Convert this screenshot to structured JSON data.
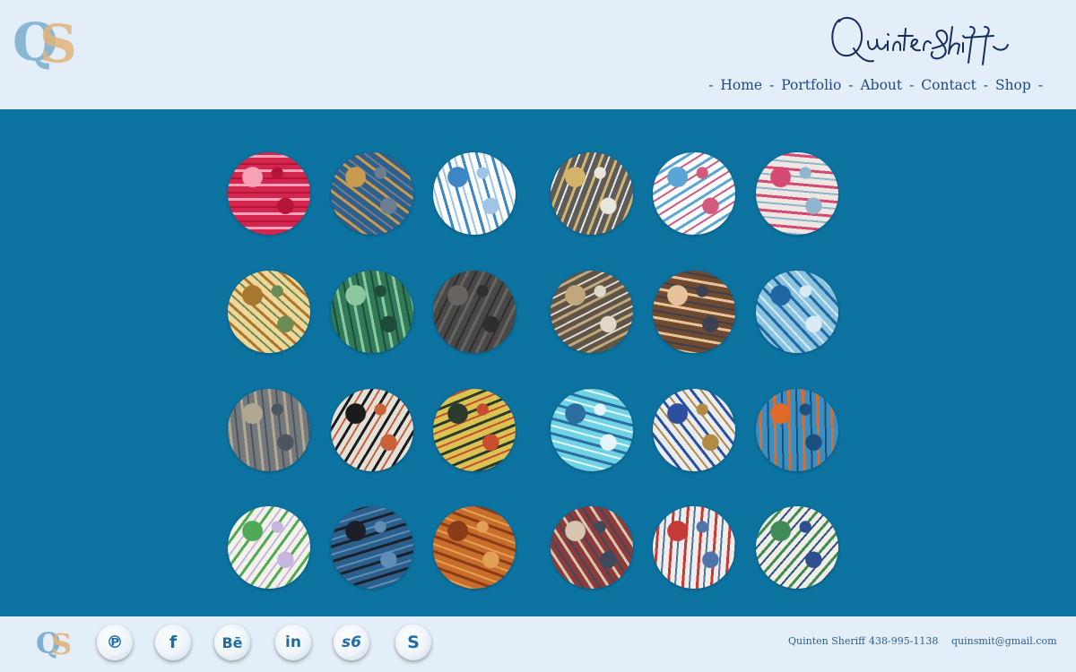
{
  "header": {
    "logo_letters": [
      "Q",
      "S"
    ],
    "signature_text": "QuintenSheriff",
    "nav": {
      "home": "Home",
      "portfolio": "Portfolio",
      "about": "About",
      "contact": "Contact",
      "shop": "Shop",
      "separator": "-"
    }
  },
  "gallery": {
    "thumbnails": [
      {
        "name": "artwork-red-bubbles",
        "colors": [
          "#d2264e",
          "#f7a1b6",
          "#b51437"
        ]
      },
      {
        "name": "artwork-blue-gold-texture",
        "colors": [
          "#2f5f8b",
          "#c99a4f",
          "#6d7e93"
        ]
      },
      {
        "name": "artwork-blue-scribble",
        "colors": [
          "#ffffff",
          "#3d86c6",
          "#9fc4e6"
        ]
      },
      {
        "name": "artwork-collage-gold-black",
        "colors": [
          "#5b5b5b",
          "#d4b36a",
          "#e9e6de"
        ]
      },
      {
        "name": "artwork-blue-drips",
        "colors": [
          "#ffffff",
          "#5aa5d6",
          "#d25b7d"
        ]
      },
      {
        "name": "artwork-pink-rose-portrait",
        "colors": [
          "#efe7e2",
          "#d44a74",
          "#8fb5cf"
        ]
      },
      {
        "name": "artwork-bamboo-gold",
        "colors": [
          "#efd79a",
          "#a7772d",
          "#6c8a53"
        ]
      },
      {
        "name": "artwork-green-stripes",
        "colors": [
          "#2f7a57",
          "#8cc7a0",
          "#1e4b3a"
        ]
      },
      {
        "name": "artwork-dark-grain",
        "colors": [
          "#4a4846",
          "#686462",
          "#302e2d"
        ]
      },
      {
        "name": "artwork-collage-boxes",
        "colors": [
          "#5e5548",
          "#c2a77d",
          "#e0d8c8"
        ]
      },
      {
        "name": "artwork-butterflies-collage",
        "colors": [
          "#6f4a2e",
          "#e6c39a",
          "#3d3f52"
        ]
      },
      {
        "name": "artwork-blue-drip-lines",
        "colors": [
          "#89c3df",
          "#1f67a2",
          "#dceaf3"
        ]
      },
      {
        "name": "artwork-grey-feather",
        "colors": [
          "#75797c",
          "#b0a890",
          "#4b5660"
        ]
      },
      {
        "name": "artwork-birds-branches",
        "colors": [
          "#e3e0da",
          "#1b1b1b",
          "#c8623a"
        ]
      },
      {
        "name": "artwork-yellow-silhouettes",
        "colors": [
          "#d9c453",
          "#2c3a2c",
          "#c84c2e"
        ]
      },
      {
        "name": "artwork-turquoise-circles",
        "colors": [
          "#6fd3e6",
          "#2b6e9f",
          "#e6f6f8"
        ]
      },
      {
        "name": "artwork-blue-white-script",
        "colors": [
          "#e9edf2",
          "#2c4f9f",
          "#b38a43"
        ]
      },
      {
        "name": "artwork-blue-orange-band",
        "colors": [
          "#3a8fc0",
          "#e06a2a",
          "#1b4f80"
        ]
      },
      {
        "name": "artwork-green-line-figure",
        "colors": [
          "#f4f3ea",
          "#4fa957",
          "#c6b5df"
        ]
      },
      {
        "name": "artwork-blue-dark-patches",
        "colors": [
          "#2b5f8d",
          "#1c1f28",
          "#5f8db4"
        ]
      },
      {
        "name": "artwork-rust-copper",
        "colors": [
          "#c86d2a",
          "#8a3b17",
          "#e2a057"
        ]
      },
      {
        "name": "artwork-angel-collage",
        "colors": [
          "#8c3b3a",
          "#d7c7b0",
          "#3c4a5c"
        ]
      },
      {
        "name": "artwork-red-script-white",
        "colors": [
          "#f1eeea",
          "#c73a3a",
          "#4f75a8"
        ]
      },
      {
        "name": "artwork-green-scribble-rings",
        "colors": [
          "#f1eee3",
          "#3f8a58",
          "#2d4f8f"
        ]
      }
    ]
  },
  "footer": {
    "logo_letters": [
      "Q",
      "S"
    ],
    "social": [
      {
        "name": "pinterest",
        "glyph": "℗"
      },
      {
        "name": "facebook",
        "glyph": "f"
      },
      {
        "name": "behance",
        "glyph": "Bē"
      },
      {
        "name": "linkedin",
        "glyph": "in"
      },
      {
        "name": "society6",
        "glyph": "s6"
      },
      {
        "name": "skype",
        "glyph": "S"
      }
    ],
    "contact_name": "Quinten Sheriff",
    "phone": "438-995-1138",
    "email": "quinsmit@gmail.com"
  },
  "colors": {
    "band": "#0c72a0",
    "background": "#e3eef8",
    "nav_text": "#1d4a86",
    "icon_blue": "#1f6ca7"
  }
}
